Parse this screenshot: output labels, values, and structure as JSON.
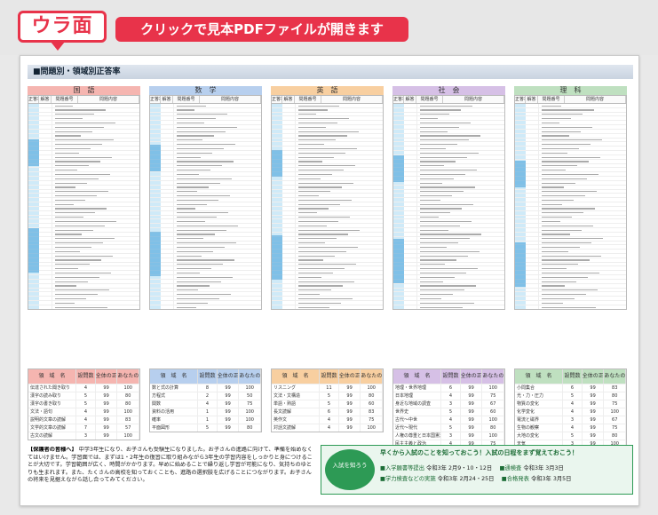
{
  "banner": {
    "tag": "ウラ面",
    "cta": "クリックで見本PDFファイルが開きます"
  },
  "sheet_title": "■問題別・領域別正答率",
  "subjects": [
    {
      "name": "国　語",
      "color": "#f5b5b0",
      "cols": [
        "正答率",
        "解答",
        "問題番号",
        "問題内容"
      ],
      "table": {
        "headers": [
          "領　域　名",
          "設問数",
          "全体の正答率",
          "あなたの正答率"
        ],
        "rows": [
          [
            "伝達された聞き取り",
            "4",
            "99",
            "100"
          ],
          [
            "漢字の読み取り",
            "5",
            "99",
            "80"
          ],
          [
            "漢字の書き取り",
            "5",
            "99",
            "80"
          ],
          [
            "文法・語句",
            "4",
            "99",
            "100"
          ],
          [
            "説明的文章の読解",
            "4",
            "99",
            "83"
          ],
          [
            "文学的文章の読解",
            "7",
            "99",
            "57"
          ],
          [
            "古文の読解",
            "3",
            "99",
            "100"
          ]
        ]
      }
    },
    {
      "name": "数　学",
      "color": "#b7cfee",
      "cols": [
        "正答率",
        "解答",
        "問題番号",
        "問題内容"
      ],
      "table": {
        "headers": [
          "領　域　名",
          "設問数",
          "全体の正答率",
          "あなたの正答率"
        ],
        "rows": [
          [
            "数と式の計算",
            "8",
            "99",
            "100"
          ],
          [
            "方程式",
            "2",
            "99",
            "50"
          ],
          [
            "関数",
            "4",
            "99",
            "75"
          ],
          [
            "資料の活用",
            "1",
            "99",
            "100"
          ],
          [
            "確率",
            "1",
            "99",
            "100"
          ],
          [
            "平面図形",
            "5",
            "99",
            "80"
          ]
        ]
      }
    },
    {
      "name": "英　語",
      "color": "#f8cfa0",
      "cols": [
        "正答率",
        "解答",
        "問題番号",
        "問題内容"
      ],
      "table": {
        "headers": [
          "領　域　名",
          "設問数",
          "全体の正答率",
          "あなたの正答率"
        ],
        "rows": [
          [
            "リスニング",
            "11",
            "99",
            "100"
          ],
          [
            "文法・文構造",
            "5",
            "99",
            "80"
          ],
          [
            "単語・熟語",
            "5",
            "99",
            "60"
          ],
          [
            "長文読解",
            "6",
            "99",
            "83"
          ],
          [
            "英作文",
            "4",
            "99",
            "75"
          ],
          [
            "対話文読解",
            "4",
            "99",
            "100"
          ]
        ]
      }
    },
    {
      "name": "社　会",
      "color": "#d6c0e6",
      "cols": [
        "正答率",
        "解答",
        "問題番号",
        "問題内容"
      ],
      "table": {
        "headers": [
          "領　域　名",
          "設問数",
          "全体の正答率",
          "あなたの正答率"
        ],
        "rows": [
          [
            "地理・世界地理",
            "6",
            "99",
            "100"
          ],
          [
            "日本地理",
            "4",
            "99",
            "75"
          ],
          [
            "身近な地域の調査",
            "3",
            "99",
            "67"
          ],
          [
            "世界史",
            "5",
            "99",
            "60"
          ],
          [
            "古代〜中世",
            "4",
            "99",
            "100"
          ],
          [
            "近代〜現代",
            "5",
            "99",
            "80"
          ],
          [
            "人権の尊重と日本国憲法",
            "3",
            "99",
            "100"
          ],
          [
            "民主主義と政治",
            "4",
            "99",
            "75"
          ]
        ]
      }
    },
    {
      "name": "理　科",
      "color": "#bfe0c0",
      "cols": [
        "正答率",
        "解答",
        "問題番号",
        "問題内容"
      ],
      "table": {
        "headers": [
          "領　域　名",
          "設問数",
          "全体の正答率",
          "あなたの正答率"
        ],
        "rows": [
          [
            "小問集合",
            "6",
            "99",
            "83"
          ],
          [
            "光・力・圧力",
            "5",
            "99",
            "80"
          ],
          [
            "物質の変化",
            "4",
            "99",
            "75"
          ],
          [
            "化学変化",
            "4",
            "99",
            "100"
          ],
          [
            "電流と磁界",
            "3",
            "99",
            "67"
          ],
          [
            "生物の観察",
            "4",
            "99",
            "75"
          ],
          [
            "大地の変化",
            "5",
            "99",
            "80"
          ],
          [
            "天気",
            "3",
            "99",
            "100"
          ]
        ]
      }
    }
  ],
  "notes": {
    "heading": "【保護者の皆様へ】",
    "body": "中学3年生になり、お子さんも受験生になりました。お子さんの進路に向けて、準備を始めなくてはいけません。学習面では、まずは1・2年生の復習に取り組みながら3年生の学習内容をしっかりと身につけることが大切です。学習範囲が広く、時間がかかります。早めに始めることで繰り返し学習が可能になり、気持ちのゆとりも生まれます。また、たくさんの高校を知っておくことも、進路の選択肢を広げることにつながります。お子さんの将来を見据えながら話し合ってみてください。"
  },
  "info_box": {
    "mascot": "入試を知ろう",
    "title": "早くから入試のことを知っておこう！入試の日程をまず覚えておこう！",
    "lines": [
      {
        "label": "■入学願書等提出",
        "value": "令和3年 2月9・10・12日",
        "label2": "■通検査",
        "value2": "令和3年 3月3日"
      },
      {
        "label": "■学力検査などの実施",
        "value": "令和3年 2月24・25日",
        "label2": "■合格発表",
        "value2": "令和3年 3月5日"
      }
    ]
  }
}
